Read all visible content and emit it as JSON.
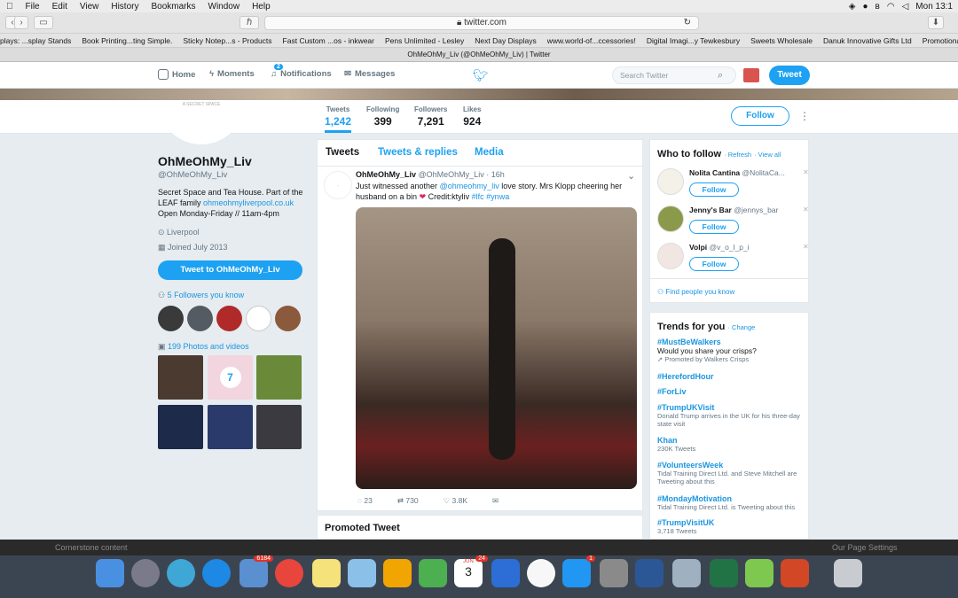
{
  "menubar": {
    "items": [
      "File",
      "Edit",
      "View",
      "History",
      "Bookmarks",
      "Window",
      "Help"
    ],
    "clock": "Mon 13:1"
  },
  "browser": {
    "url": "twitter.com",
    "tab_title": "OhMeOhMy_Liv (@OhMeOhMy_Liv) | Twitter",
    "bookmarks": [
      "plays: ...splay Stands",
      "Book Printing...ting Simple.",
      "Sticky Notep...s - Products",
      "Fast Custom ...os - inkwear",
      "Pens Unlimited - Lesley",
      "Next Day Displays",
      "www.world-of...ccessories!",
      "Digital Imagi...y Tewkesbury",
      "Sweets Wholesale",
      "Danuk Innovative Gifts Ltd",
      "Promotional ...and Displays"
    ]
  },
  "nav": {
    "home": "Home",
    "moments": "Moments",
    "notifications": "Notifications",
    "notif_count": "2",
    "messages": "Messages",
    "search_placeholder": "Search Twitter",
    "tweet": "Tweet"
  },
  "profile": {
    "avatar_text": "A SECRET SPACE",
    "name": "OhMeOhMy_Liv",
    "handle": "@OhMeOhMy_Liv",
    "bio1": "Secret Space and Tea House. Part of the",
    "bio2": "LEAF family",
    "bio_link": "ohmeohmyliverpool.co.uk",
    "bio3": "Open Monday-Friday // 11am-4pm",
    "location": "Liverpool",
    "joined": "Joined July 2013",
    "tweet_to": "Tweet to OhMeOhMy_Liv",
    "followers_you_know": "5 Followers you know",
    "photos": "199 Photos and videos",
    "photo_badge": "7"
  },
  "stats": [
    {
      "label": "Tweets",
      "value": "1,242"
    },
    {
      "label": "Following",
      "value": "399"
    },
    {
      "label": "Followers",
      "value": "7,291"
    },
    {
      "label": "Likes",
      "value": "924"
    }
  ],
  "follow": "Follow",
  "tabs": [
    "Tweets",
    "Tweets & replies",
    "Media"
  ],
  "tweet": {
    "name": "OhMeOhMy_Liv",
    "handle": "@OhMeOhMy_Liv",
    "time": "· 16h",
    "l1": "Just witnessed another",
    "mention": "@ohmeohmy_liv",
    "l1b": "love story. Mrs Klopp cheering her",
    "l2": "husband on a bin",
    "l2b": "Credit:ktyliv",
    "tags": "#lfc #ynwa",
    "replies": "23",
    "retweets": "730",
    "likes": "3.8K"
  },
  "promoted": "Promoted Tweet",
  "who_to_follow": {
    "title": "Who to follow",
    "refresh": "· Refresh",
    "view_all": "· View all",
    "find": "Find people you know",
    "users": [
      {
        "name": "Nolita Cantina",
        "handle": "@NolitaCa..."
      },
      {
        "name": "Jenny's Bar",
        "handle": "@jennys_bar"
      },
      {
        "name": "Volpi",
        "handle": "@v_o_l_p_i"
      }
    ]
  },
  "trends": {
    "title": "Trends for you",
    "change": "· Change",
    "items": [
      {
        "tag": "#MustBeWalkers",
        "sub": "Would you share your crisps?",
        "sub2": "Promoted by Walkers Crisps"
      },
      {
        "tag": "#HerefordHour",
        "sub": ""
      },
      {
        "tag": "#ForLiv",
        "sub": ""
      },
      {
        "tag": "#TrumpUKVisit",
        "sub": "Donald Trump arrives in the UK for his three-day state visit"
      },
      {
        "tag": "Khan",
        "sub": "230K Tweets"
      },
      {
        "tag": "#VolunteersWeek",
        "sub": "Tidal Training Direct Ltd. and Steve Mitchell are Tweeting about this"
      },
      {
        "tag": "#MondayMotivation",
        "sub": "Tidal Training Direct Ltd. is Tweeting about this"
      },
      {
        "tag": "#TrumpVisitUK",
        "sub": "3,718 Tweets"
      }
    ]
  },
  "bottom": {
    "left": "Cornerstone content",
    "right": "Our Page Settings"
  },
  "dock": {
    "mail_badge": "6184",
    "cal_month": "JUN",
    "cal_day": "3",
    "cal_badge": "24",
    "store_badge": "1"
  }
}
